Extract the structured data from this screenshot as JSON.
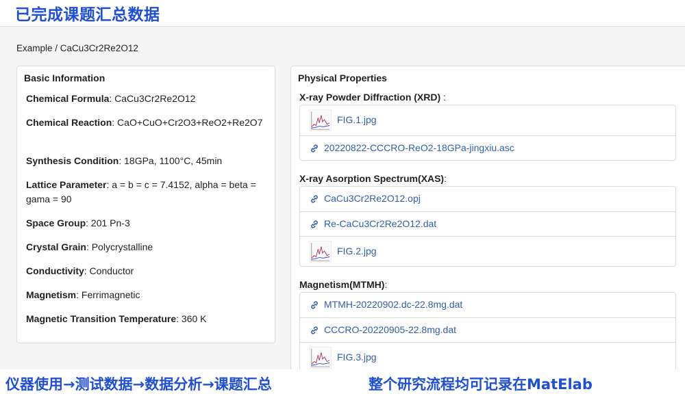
{
  "banner": {
    "top": "已完成课题汇总数据",
    "bottom_left": "仪器使用→测试数据→数据分析→课题汇总",
    "bottom_right": "整个研究流程均可记录在MatElab"
  },
  "breadcrumb": "Example / CaCu3Cr2Re2O12",
  "basic": {
    "title": "Basic Information",
    "fields": [
      {
        "label": "Chemical Formula",
        "value": ": CaCu3Cr2Re2O12"
      },
      {
        "label": "Chemical Reaction",
        "value": ": CaO+CuO+Cr2O3+ReO2+Re2O7"
      },
      {
        "label": "Synthesis Condition",
        "value": ": 18GPa, 1100°C, 45min"
      },
      {
        "label": "Lattice Parameter",
        "value": ": a = b = c = 7.4152, alpha = beta = gama = 90"
      },
      {
        "label": "Space Group",
        "value": ": 201 Pn-3"
      },
      {
        "label": "Crystal Grain",
        "value": ": Polycrystalline"
      },
      {
        "label": "Conductivity",
        "value": ": Conductor"
      },
      {
        "label": "Magnetism",
        "value": ": Ferrimagnetic"
      },
      {
        "label": "Magnetic Transition Temperature",
        "value": ": 360 K"
      }
    ]
  },
  "physical": {
    "title": "Physical Properties",
    "sections": [
      {
        "title": "X-ray Powder Diffraction (XRD)",
        "colon": " :",
        "items": [
          {
            "type": "image",
            "label": "FIG.1.jpg"
          },
          {
            "type": "link",
            "label": "20220822-CCCRO-ReO2-18GPa-jingxiu.asc"
          }
        ]
      },
      {
        "title": "X-ray Asorption Spectrum(XAS)",
        "colon": ":",
        "items": [
          {
            "type": "link",
            "label": "CaCu3Cr2Re2O12.opj"
          },
          {
            "type": "link",
            "label": "Re-CaCu3Cr2Re2O12.dat"
          },
          {
            "type": "image",
            "label": "FIG.2.jpg"
          }
        ]
      },
      {
        "title": "Magnetism(MTMH)",
        "colon": ":",
        "items": [
          {
            "type": "link",
            "label": "MTMH-20220902.dc-22.8mg.dat"
          },
          {
            "type": "link",
            "label": "CCCRO-20220905-22.8mg.dat"
          },
          {
            "type": "image",
            "label": "FIG.3.jpg"
          }
        ]
      }
    ]
  },
  "colors": {
    "accent": "#1f4fd6",
    "link": "#2f5fad"
  }
}
